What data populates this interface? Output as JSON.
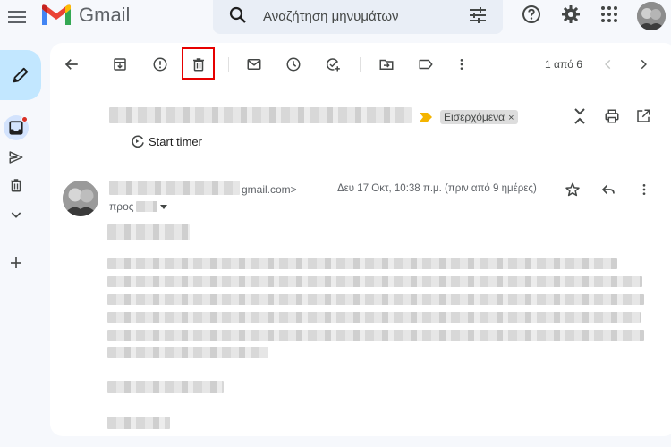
{
  "app": {
    "brand": "Gmail"
  },
  "search": {
    "placeholder": "Αναζήτηση μηνυμάτων"
  },
  "toolbar": {
    "pagination": "1 από 6"
  },
  "message": {
    "label": "Εισερχόμενα",
    "label_remove": "×",
    "start_timer": "Start timer",
    "sender_email_suffix": "gmail.com>",
    "recipient_prefix": "προς",
    "date": "Δευ 17 Οκτ, 10:38 π.μ. (πριν από 9 ημέρες)"
  },
  "colors": {
    "gmail_red": "#ea4335",
    "gmail_blue": "#4285f4",
    "gmail_green": "#34a853",
    "gmail_yellow": "#fbbc04",
    "compose_bg": "#c2e7ff",
    "highlight_border": "#e60000",
    "important_marker": "#f4b400"
  },
  "icons": {
    "main_menu": "hamburger-icon",
    "search": "search-icon",
    "filters": "tune-icon",
    "help": "help-icon",
    "settings": "gear-icon",
    "apps": "apps-grid-icon",
    "compose": "pencil-icon",
    "inbox": "inbox-icon",
    "sent": "send-icon",
    "trash": "trash-icon",
    "more_labels": "chevron-down-icon",
    "add_label": "plus-icon",
    "back": "arrow-left-icon",
    "archive": "archive-icon",
    "report_spam": "report-icon",
    "delete": "trash-icon",
    "mark_unread": "mail-icon",
    "snooze": "clock-icon",
    "add_to_tasks": "add-task-icon",
    "move_to": "move-folder-icon",
    "labels": "label-icon",
    "more": "more-vert-icon",
    "prev": "chevron-left-icon",
    "next": "chevron-right-icon",
    "expand_all": "unfold-icon",
    "print": "print-icon",
    "open_new_window": "open-in-new-icon",
    "star": "star-icon",
    "reply": "reply-icon",
    "message_more": "more-vert-icon",
    "recipient_dropdown": "caret-down-icon",
    "timer": "timer-icon"
  }
}
